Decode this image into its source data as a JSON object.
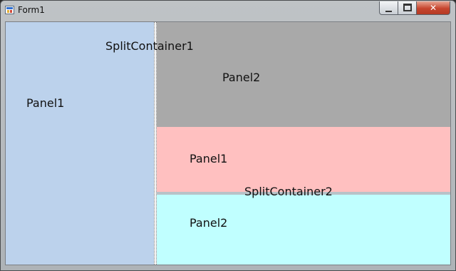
{
  "window": {
    "title": "Form1",
    "controls": {
      "minimize": "minimize",
      "maximize": "maximize",
      "close": "close"
    }
  },
  "labels": {
    "split_container_1": "SplitContainer1",
    "left_panel": "Panel1",
    "top_right_panel": "Panel2",
    "middle_panel": "Panel1",
    "split_container_2": "SplitContainer2",
    "bottom_panel": "Panel2"
  },
  "colors": {
    "panel1_blue": "#bcd2ec",
    "panel2_gray": "#a9a9a9",
    "panel1_pink": "#ffc0c0",
    "panel2_cyan": "#c0ffff"
  },
  "icons": {
    "app_icon": "form-app-icon",
    "minimize": "minimize-icon",
    "maximize": "maximize-icon",
    "close": "close-icon"
  }
}
